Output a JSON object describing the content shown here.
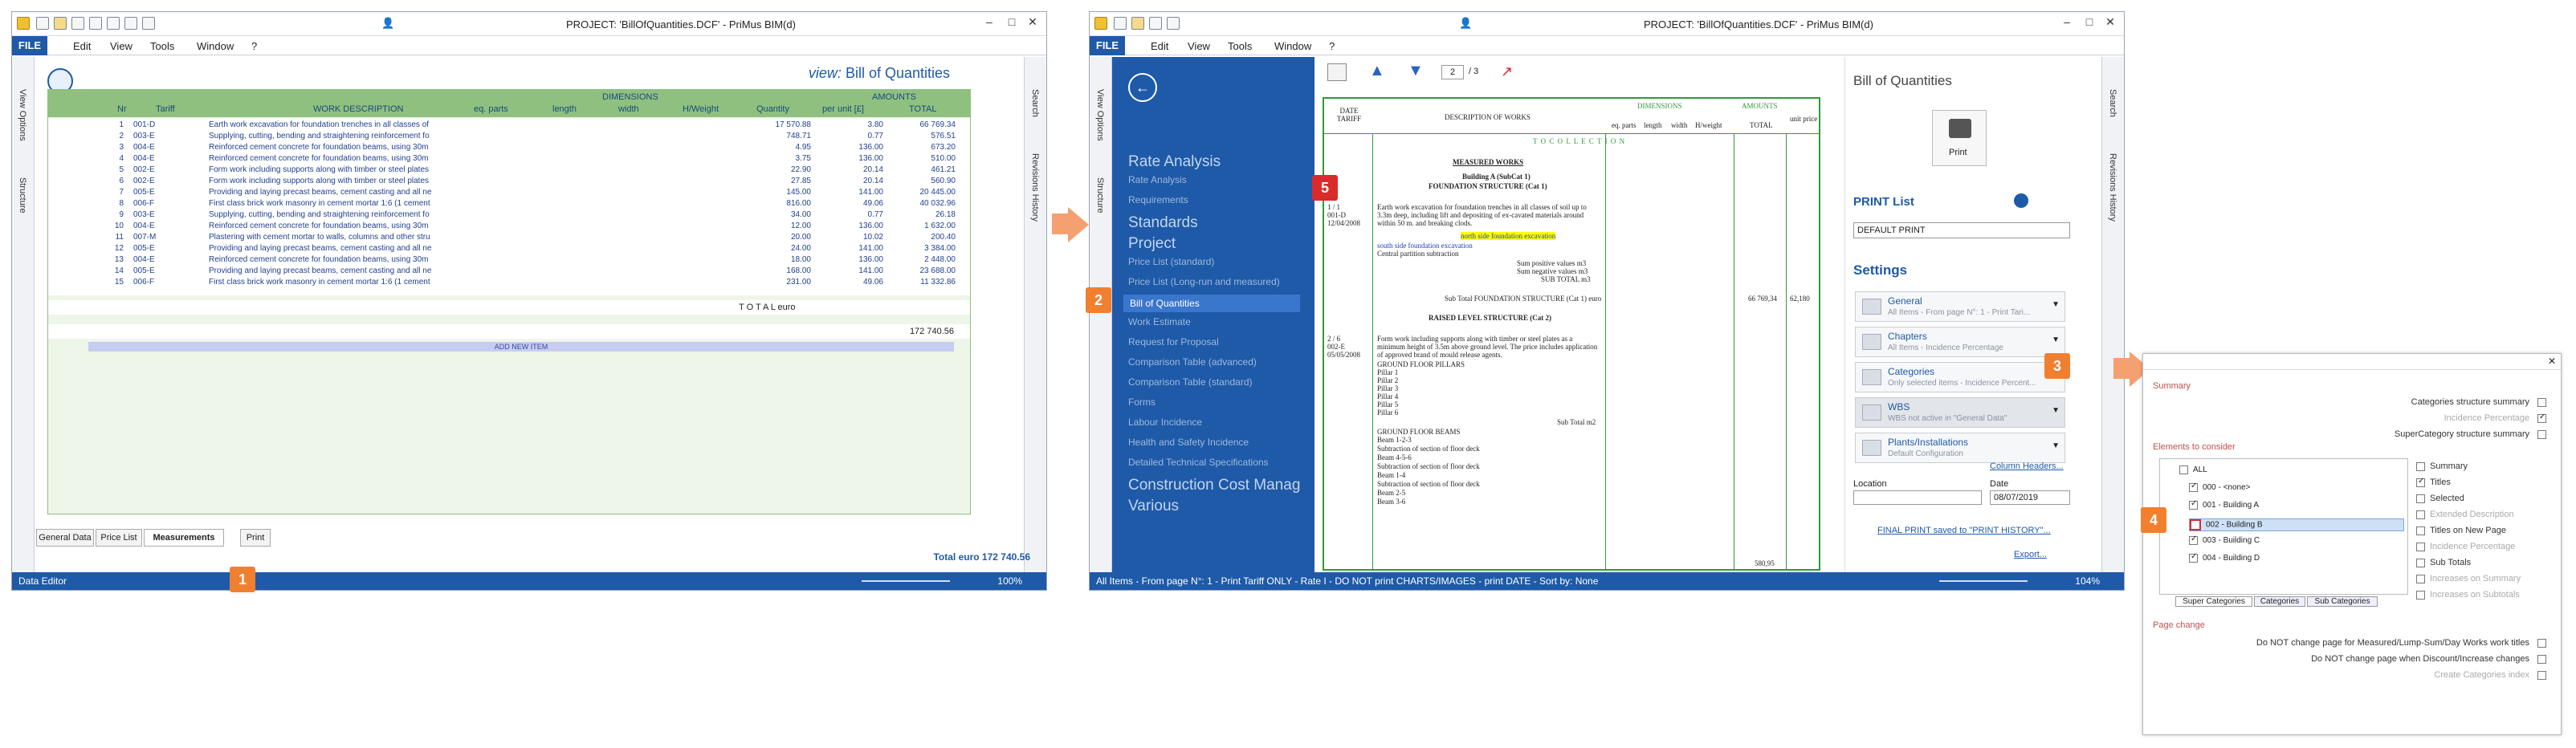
{
  "win1": {
    "title": "PROJECT: 'BillOfQuantities.DCF' - PriMus    BIM(d)",
    "menu": [
      "FILE",
      "Edit",
      "View",
      "Tools",
      "Window",
      "?"
    ],
    "view_prefix": "view:",
    "view_name": "Bill of Quantities",
    "side_labels": [
      "View Options",
      "Structure"
    ],
    "right_labels": [
      "Search",
      "Revisions History"
    ],
    "headers": {
      "nr": "Nr",
      "tariff": "Tariff",
      "desc": "WORK DESCRIPTION",
      "dims": "DIMENSIONS",
      "eqparts": "eq. parts",
      "length": "length",
      "width": "width",
      "height": "H/Weight",
      "qty": "Quantity",
      "amounts": "AMOUNTS",
      "unit": "per unit [£]",
      "total": "TOTAL"
    },
    "rows": [
      {
        "nr": "1",
        "tariff": "001-D",
        "desc": "Earth work excavation for foundation trenches in all classes of",
        "qty": "17 570.88",
        "unit": "3.80",
        "total": "66 769.34"
      },
      {
        "nr": "2",
        "tariff": "003-E",
        "desc": "Supplying, cutting, bending and straightening reinforcement fo",
        "qty": "748.71",
        "unit": "0.77",
        "total": "576.51"
      },
      {
        "nr": "3",
        "tariff": "004-E",
        "desc": "Reinforced cement concrete for foundation beams, using 30m",
        "qty": "4.95",
        "unit": "136.00",
        "total": "673.20"
      },
      {
        "nr": "4",
        "tariff": "004-E",
        "desc": "Reinforced cement concrete for foundation beams, using 30m",
        "qty": "3.75",
        "unit": "136.00",
        "total": "510.00"
      },
      {
        "nr": "5",
        "tariff": "002-E",
        "desc": "Form work including supports along with timber or steel plates",
        "qty": "22.90",
        "unit": "20.14",
        "total": "461.21"
      },
      {
        "nr": "6",
        "tariff": "002-E",
        "desc": "Form work including supports along with timber or steel plates",
        "qty": "27.85",
        "unit": "20.14",
        "total": "560.90"
      },
      {
        "nr": "7",
        "tariff": "005-E",
        "desc": "Providing and laying precast beams, cement casting and all ne",
        "qty": "145.00",
        "unit": "141.00",
        "total": "20 445.00"
      },
      {
        "nr": "8",
        "tariff": "006-F",
        "desc": "First class brick work masonry in cement mortar 1:6 (1 cement",
        "qty": "816.00",
        "unit": "49.06",
        "total": "40 032.96"
      },
      {
        "nr": "9",
        "tariff": "003-E",
        "desc": "Supplying, cutting, bending and straightening reinforcement fo",
        "qty": "34.00",
        "unit": "0.77",
        "total": "26.18"
      },
      {
        "nr": "10",
        "tariff": "004-E",
        "desc": "Reinforced cement concrete for foundation beams, using 30m",
        "qty": "12.00",
        "unit": "136.00",
        "total": "1 632.00"
      },
      {
        "nr": "11",
        "tariff": "007-M",
        "desc": "Plastering with cement mortar to walls, columns and other stru",
        "qty": "20.00",
        "unit": "10.02",
        "total": "200.40"
      },
      {
        "nr": "12",
        "tariff": "005-E",
        "desc": "Providing and laying precast beams, cement casting and all ne",
        "qty": "24.00",
        "unit": "141.00",
        "total": "3 384.00"
      },
      {
        "nr": "13",
        "tariff": "004-E",
        "desc": "Reinforced cement concrete for foundation beams, using 30m",
        "qty": "18.00",
        "unit": "136.00",
        "total": "2 448.00"
      },
      {
        "nr": "14",
        "tariff": "005-E",
        "desc": "Providing and laying precast beams, cement casting and all ne",
        "qty": "168.00",
        "unit": "141.00",
        "total": "23 688.00"
      },
      {
        "nr": "15",
        "tariff": "006-F",
        "desc": "First class brick work masonry in cement mortar 1:6 (1 cement",
        "qty": "231.00",
        "unit": "49.06",
        "total": "11 332.86"
      }
    ],
    "total_label": "T O T A L  euro",
    "total_value": "172 740.56",
    "add_item": "ADD NEW ITEM",
    "tabs": [
      "General Data",
      "Price List",
      "Measurements",
      "Print"
    ],
    "footer_total": "Total  euro  172 740.56",
    "status": "Data Editor",
    "zoom": "100%"
  },
  "win2": {
    "title": "PROJECT: 'BillOfQuantities.DCF' - PriMus    BIM(d)",
    "menu": [
      "FILE",
      "Edit",
      "View",
      "Tools",
      "Window",
      "?"
    ],
    "page_input": "2",
    "page_total": "/ 3",
    "nav": [
      {
        "t": "head",
        "label": "Rate Analysis"
      },
      {
        "t": "item",
        "label": "Rate Analysis"
      },
      {
        "t": "item",
        "label": "Requirements"
      },
      {
        "t": "head",
        "label": "Standards"
      },
      {
        "t": "head",
        "label": "Project"
      },
      {
        "t": "item",
        "label": "Price List (standard)"
      },
      {
        "t": "item",
        "label": "Price List (Long-run and measured)"
      },
      {
        "t": "sel",
        "label": "Bill of Quantities"
      },
      {
        "t": "item",
        "label": "Work Estimate"
      },
      {
        "t": "item",
        "label": "Request for Proposal"
      },
      {
        "t": "item",
        "label": "Comparison Table (advanced)"
      },
      {
        "t": "item",
        "label": "Comparison Table (standard)"
      },
      {
        "t": "item",
        "label": "Forms"
      },
      {
        "t": "item",
        "label": "Labour Incidence"
      },
      {
        "t": "item",
        "label": "Health and Safety Incidence"
      },
      {
        "t": "item",
        "label": "Detailed Technical Specifications"
      },
      {
        "t": "head",
        "label": "Construction Cost Manag"
      },
      {
        "t": "head",
        "label": "Various"
      }
    ],
    "doc": {
      "h_date": "DATE TARIFF",
      "h_desc": "DESCRIPTION OF WORKS",
      "h_dims": "DIMENSIONS",
      "h_amounts": "AMOUNTS",
      "h_eq": "eq. parts",
      "h_len": "length",
      "h_wid": "width",
      "h_hw": "H/weight",
      "h_tot": "TOTAL",
      "h_unit": "unit price",
      "to_collection": "T O   C O L L E C T I O N",
      "measured": "MEASURED WORKS",
      "build_a": "Building A  (SubCat 1)",
      "found": "FOUNDATION STRUCTURE  (Cat 1)",
      "i1_ref": "1 / 1\n001-D\n12/04/2008",
      "i1_desc": "Earth work excavation for foundation trenches in all classes of soil up to 3.3m deep, including lift and depositing of ex-cavated materials around within 50 m. and breaking clods.",
      "hl": "north side foundation excavation",
      "sub1": "south side foundation excavation",
      "sub2": "Central partition subtraction",
      "sumpos": "Sum positive values m3",
      "sumneg": "Sum negative values m3",
      "subtot": "SUB TOTAL m3",
      "subtot_found": "Sub Total FOUNDATION STRUCTURE  (Cat 1) euro",
      "v1": "66 769,34",
      "v2": "62,180",
      "raised": "RAISED LEVEL STRUCTURE  (Cat 2)",
      "i2_ref": "2 / 6\n002-E\n05/05/2008",
      "i2_desc": "Form work including supports along with timber or steel plates as a minimum height of 3.5m above ground level. The price includes application of approved brand of mould release agents.",
      "gfp": "GROUND FLOOR PILLARS",
      "pillars": [
        "Pillar 1",
        "Pillar 2",
        "Pillar 3",
        "Pillar 4",
        "Pillar 5",
        "Pillar 6"
      ],
      "subtotm2": "Sub Total m2",
      "gfb": "GROUND FLOOR BEAMS",
      "beams": [
        "Beam 1-2-3",
        "Subtraction of section of floor deck",
        "Beam 4-5-6",
        "Subtraction of section of floor deck",
        "Beam 1-4",
        "Subtraction of section of floor deck",
        "Beam 2-5",
        "Beam 3-6"
      ],
      "total_bottom": "580,95"
    },
    "settings": {
      "title": "Bill of Quantities",
      "print": "Print",
      "print_list": "PRINT List",
      "print_default": "DEFAULT PRINT",
      "settings": "Settings",
      "items": [
        {
          "t": "General",
          "s": "All Items - From page N°: 1 - Print Tari..."
        },
        {
          "t": "Chapters",
          "s": "All Items - Incidence Percentage"
        },
        {
          "t": "Categories",
          "s": "Only selected items - Incidence Percent..."
        },
        {
          "t": "WBS",
          "s": "WBS not active in \"General Data\""
        },
        {
          "t": "Plants/Installations",
          "s": "Default Configuration"
        }
      ],
      "colheaders": "Column Headers...",
      "location": "Location",
      "date_label": "Date",
      "date": "08/07/2019",
      "final": "FINAL PRINT saved to \"PRINT HISTORY\"...",
      "export": "Export..."
    },
    "status": "All Items - From page N°: 1 - Print Tariff ONLY - Rate I - DO NOT print CHARTS/IMAGES - print DATE - Sort by: None",
    "zoom": "104%"
  },
  "dlg": {
    "summary": "Summary",
    "sum_opts": [
      "Categories structure summary",
      "Incidence Percentage",
      "SuperCategory structure summary"
    ],
    "elements": "Elements to consider",
    "tree": [
      "ALL",
      "000 - <none>",
      "001 - Building A",
      "002 - Building B",
      "003 - Building C",
      "004 - Building D"
    ],
    "right_opts": [
      "Summary",
      "Titles",
      "Selected",
      "Extended Description",
      "Titles on New Page",
      "Incidence Percentage",
      "Sub Totals",
      "Increases on Summary",
      "Increases on Subtotals"
    ],
    "subtabs": [
      "Super Categories",
      "Categories",
      "Sub Categories"
    ],
    "pagechange": "Page change",
    "pc_opts": [
      "Do NOT change page for Measured/Lump-Sum/Day Works work titles",
      "Do NOT change page when Discount/Increase changes",
      "Create Categories index"
    ]
  },
  "callouts": [
    "1",
    "2",
    "3",
    "4",
    "5"
  ],
  "colors": {
    "blue": "#1e5aa8",
    "green": "#8fc07f",
    "orange": "#f08030",
    "red": "#d92b2b"
  }
}
